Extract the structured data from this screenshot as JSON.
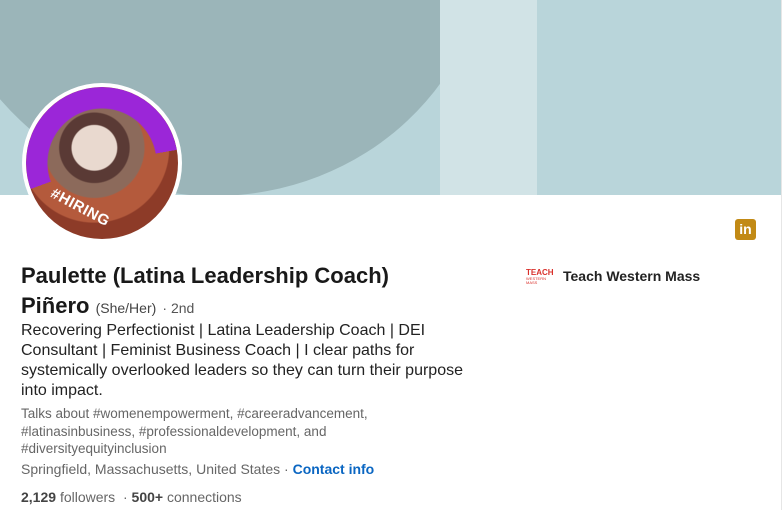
{
  "profile": {
    "name_line1": "Paulette (Latina Leadership Coach)",
    "name_line2": "Piñero",
    "pronouns": "(She/Her)",
    "degree": "· 2nd",
    "headline": "Recovering Perfectionist | Latina Leadership Coach | DEI Consultant | Feminist Business Coach | I clear paths for systemically overlooked leaders so they can turn their purpose into impact.",
    "talks_about": "Talks about #womenempowerment, #careeradvancement, #latinasinbusiness, #professionaldevelopment, and #diversityequityinclusion",
    "location": "Springfield, Massachusetts, United States ·",
    "contact_info": "Contact info",
    "followers_count": "2,129",
    "followers_label": "followers",
    "connections_sep": "·",
    "connections_count": "500+",
    "connections_label": "connections",
    "hiring_frame_text": "#HIRING"
  },
  "company": {
    "logo_text": "TEACH",
    "logo_subtext": "WESTERN MASS",
    "name": "Teach Western Mass"
  },
  "badge": {
    "text": "in",
    "icon": "linkedin-icon",
    "color": "#c28a15"
  },
  "colors": {
    "banner_light": "#b9d5da",
    "banner_dark": "#9bb5b9",
    "link": "#0a66c2",
    "hiring_frame": "#9b26d8"
  }
}
